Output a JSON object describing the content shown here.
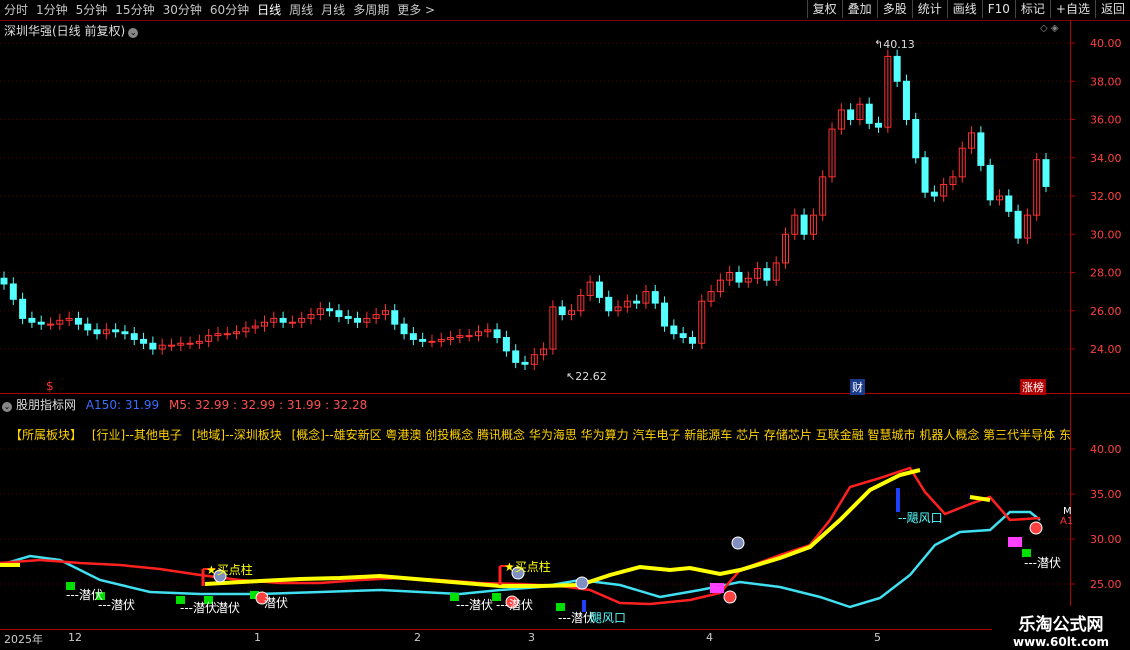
{
  "toolbar": {
    "periods": [
      "分时",
      "1分钟",
      "5分钟",
      "15分钟",
      "30分钟",
      "60分钟",
      "日线",
      "周线",
      "月线",
      "多周期",
      "更多 >"
    ],
    "active_period": "日线",
    "actions": [
      "复权",
      "叠加",
      "多股",
      "统计",
      "画线",
      "F10",
      "标记",
      "+自选",
      "返回"
    ]
  },
  "stock": {
    "title": "深圳华强(日线 前复权)"
  },
  "main_chart": {
    "y_ticks": [
      "40.00",
      "38.00",
      "36.00",
      "34.00",
      "32.00",
      "30.00",
      "28.00",
      "26.00",
      "24.00"
    ],
    "high_label": "40.13",
    "low_label": "22.62",
    "markers": {
      "dollar": "$",
      "cai": "财",
      "zhangting": "涨榜"
    }
  },
  "indicator": {
    "name": "股朋指标网",
    "a150_label": "A150: 31.99",
    "m5_label": "M5: 32.99 : 32.99 : 31.99 : 32.28"
  },
  "blocks": {
    "header": "【所属板块】",
    "industry": "[行业]--其他电子",
    "region": "[地域]--深圳板块",
    "concepts": "[概念]--雄安新区 粤港澳 创投概念 腾讯概念 华为海思 华为算力 汽车电子 新能源车 芯片 存储芯片 互联金融 智慧城市 机器人概念 第三代半导体 东"
  },
  "sub_chart": {
    "y_ticks": [
      "40.00",
      "35.00",
      "30.00",
      "25.00"
    ],
    "labels": {
      "qianfu": "潜伏",
      "maidian": "买点柱",
      "fengkou": "飓风口",
      "m_tag": "M",
      "a_tag": "A1"
    }
  },
  "dates": [
    "2025年",
    "12",
    "1",
    "2",
    "3",
    "4",
    "5"
  ],
  "watermark": {
    "line1": "乐淘公式网",
    "line2": "www.60lt.com"
  },
  "colors": {
    "up": "#ff3232",
    "down": "#54ffff",
    "yellow": "#ffff00",
    "axis": "#b00000"
  }
}
